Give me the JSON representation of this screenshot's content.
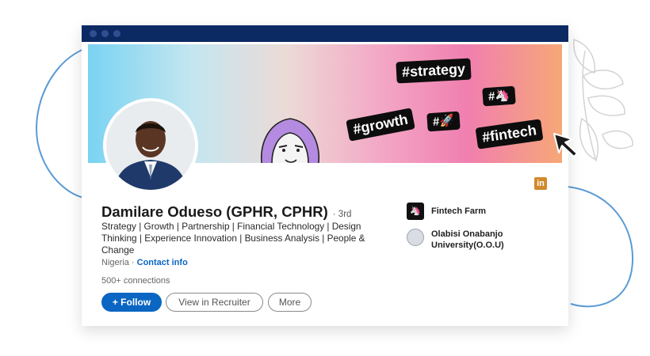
{
  "banner": {
    "hashtags": [
      "#strategy",
      "#growth",
      "#🦄",
      "#🚀",
      "#fintech"
    ]
  },
  "profile": {
    "name": "Damilare Odueso (GPHR, CPHR)",
    "degree": "· 3rd",
    "headline": "Strategy | Growth | Partnership | Financial Technology | Design Thinking | Experience Innovation | Business Analysis | People & Change",
    "location": "Nigeria · ",
    "contact_info": "Contact info",
    "connections": "500+ connections"
  },
  "actions": {
    "follow": "+ Follow",
    "view_in_recruiter": "View in Recruiter",
    "more": "More"
  },
  "experience": [
    {
      "label": "Fintech Farm",
      "logo_glyph": "🦄"
    },
    {
      "label": "Olabisi Onabanjo University(O.O.U)"
    }
  ],
  "linkedin_badge": "in",
  "colors": {
    "titlebar": "#0b2a63",
    "accent_blue": "#0a66c2",
    "deco_line": "#5b9bd5"
  }
}
